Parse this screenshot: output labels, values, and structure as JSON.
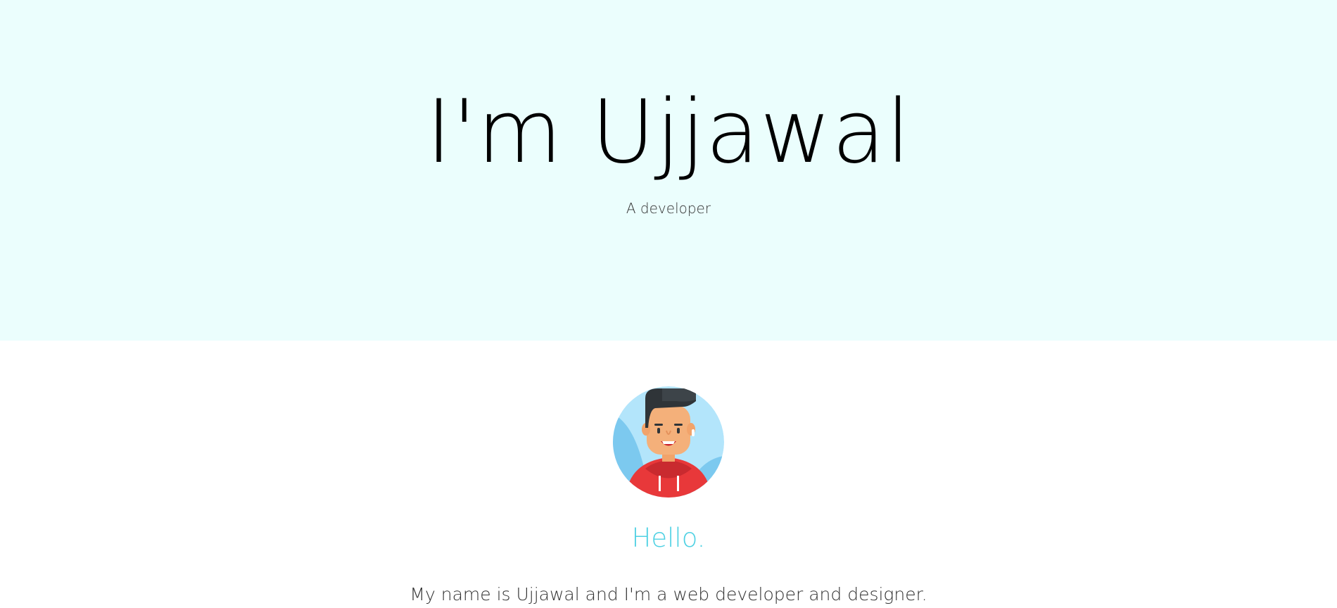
{
  "hero": {
    "title": "I'm Ujjawal",
    "subtitle": "A developer"
  },
  "about": {
    "avatar_icon": "developer-avatar-icon",
    "greeting": "Hello.",
    "intro": "My name is Ujjawal and I'm a web developer and designer."
  },
  "colors": {
    "hero_background": "#ebfefd",
    "accent": "#4fd1e3",
    "text": "#333333",
    "hoodie": "#e83a3a"
  }
}
